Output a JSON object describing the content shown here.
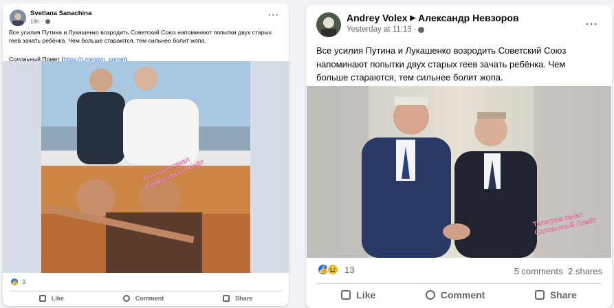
{
  "left_post": {
    "author": "Svetlana Sanachina",
    "time": "19h",
    "text": "Все усилия Путина и Лукашенко возродить Советский Союз напоминают попытки двух старых геев зачать ребёнка. Чем больше стараются, тем сильнее болит жопа.",
    "source_label": "Соловьный Помет",
    "source_link": "https://t.me/slvn_pomet",
    "watermark": "Телеграм канал\nСоловьиный Помёт",
    "reaction_count": "3",
    "actions": {
      "like": "Like",
      "comment": "Comment",
      "share": "Share"
    }
  },
  "right_post": {
    "author": "Andrey Volex",
    "target": "Александр Невзоров",
    "time": "Yesterday at 11:13",
    "text": "Все усилия Путина и Лукашенко возродить Советский Союз напоминают попытки двух старых геев зачать ребёнка. Чем больше стараются, тем сильнее болит жопа.",
    "watermark": "Телеграм канал\nСоловьиный Помёт",
    "reaction_count": "13",
    "comments": "5 comments",
    "shares": "2 shares",
    "actions": {
      "like": "Like",
      "comment": "Comment",
      "share": "Share"
    }
  },
  "icons": {
    "more": "more-horizontal-icon",
    "globe": "globe-icon",
    "like": "thumbs-up-icon",
    "comment": "comment-icon",
    "share": "share-icon"
  }
}
